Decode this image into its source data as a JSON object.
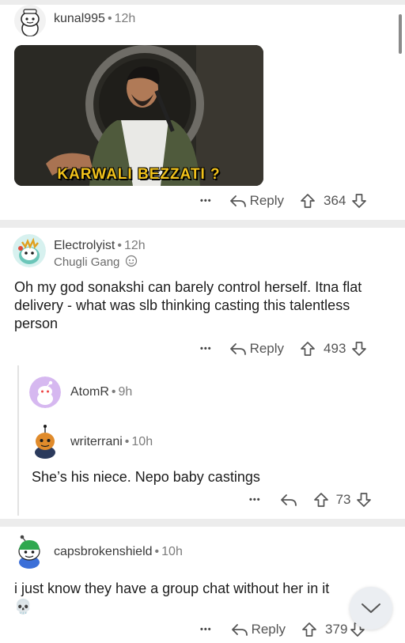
{
  "comments": [
    {
      "username": "kunal995",
      "time": "12h",
      "image_caption": "KARWALI BEZZATI ?",
      "reply_label": "Reply",
      "score": "364",
      "more": "•••"
    },
    {
      "username": "Electrolyist",
      "time": "12h",
      "flair": "Chugli Gang",
      "text": "Oh my god sonakshi can barely control herself. Itna flat delivery - what was slb thinking casting this talentless person",
      "reply_label": "Reply",
      "score": "493",
      "more": "•••",
      "replies": [
        {
          "username": "AtomR",
          "time": "9h",
          "collapsed": true
        },
        {
          "username": "writerrani",
          "time": "10h",
          "text": "She’s his niece. Nepo baby castings",
          "score": "73",
          "more": "•••"
        }
      ]
    },
    {
      "username": "capsbrokenshield",
      "time": "10h",
      "text": "i just know they have a group chat without her in it",
      "emoji": "💀",
      "reply_label": "Reply",
      "score": "379",
      "more": "•••"
    }
  ],
  "icons": {
    "reply": "reply-arrow-icon",
    "upvote": "upvote-arrow-icon",
    "downvote": "downvote-arrow-icon",
    "scroll_down": "chevron-down-icon"
  },
  "colors": {
    "divider": "#ececec",
    "meme_caption": "#f1c21b"
  }
}
